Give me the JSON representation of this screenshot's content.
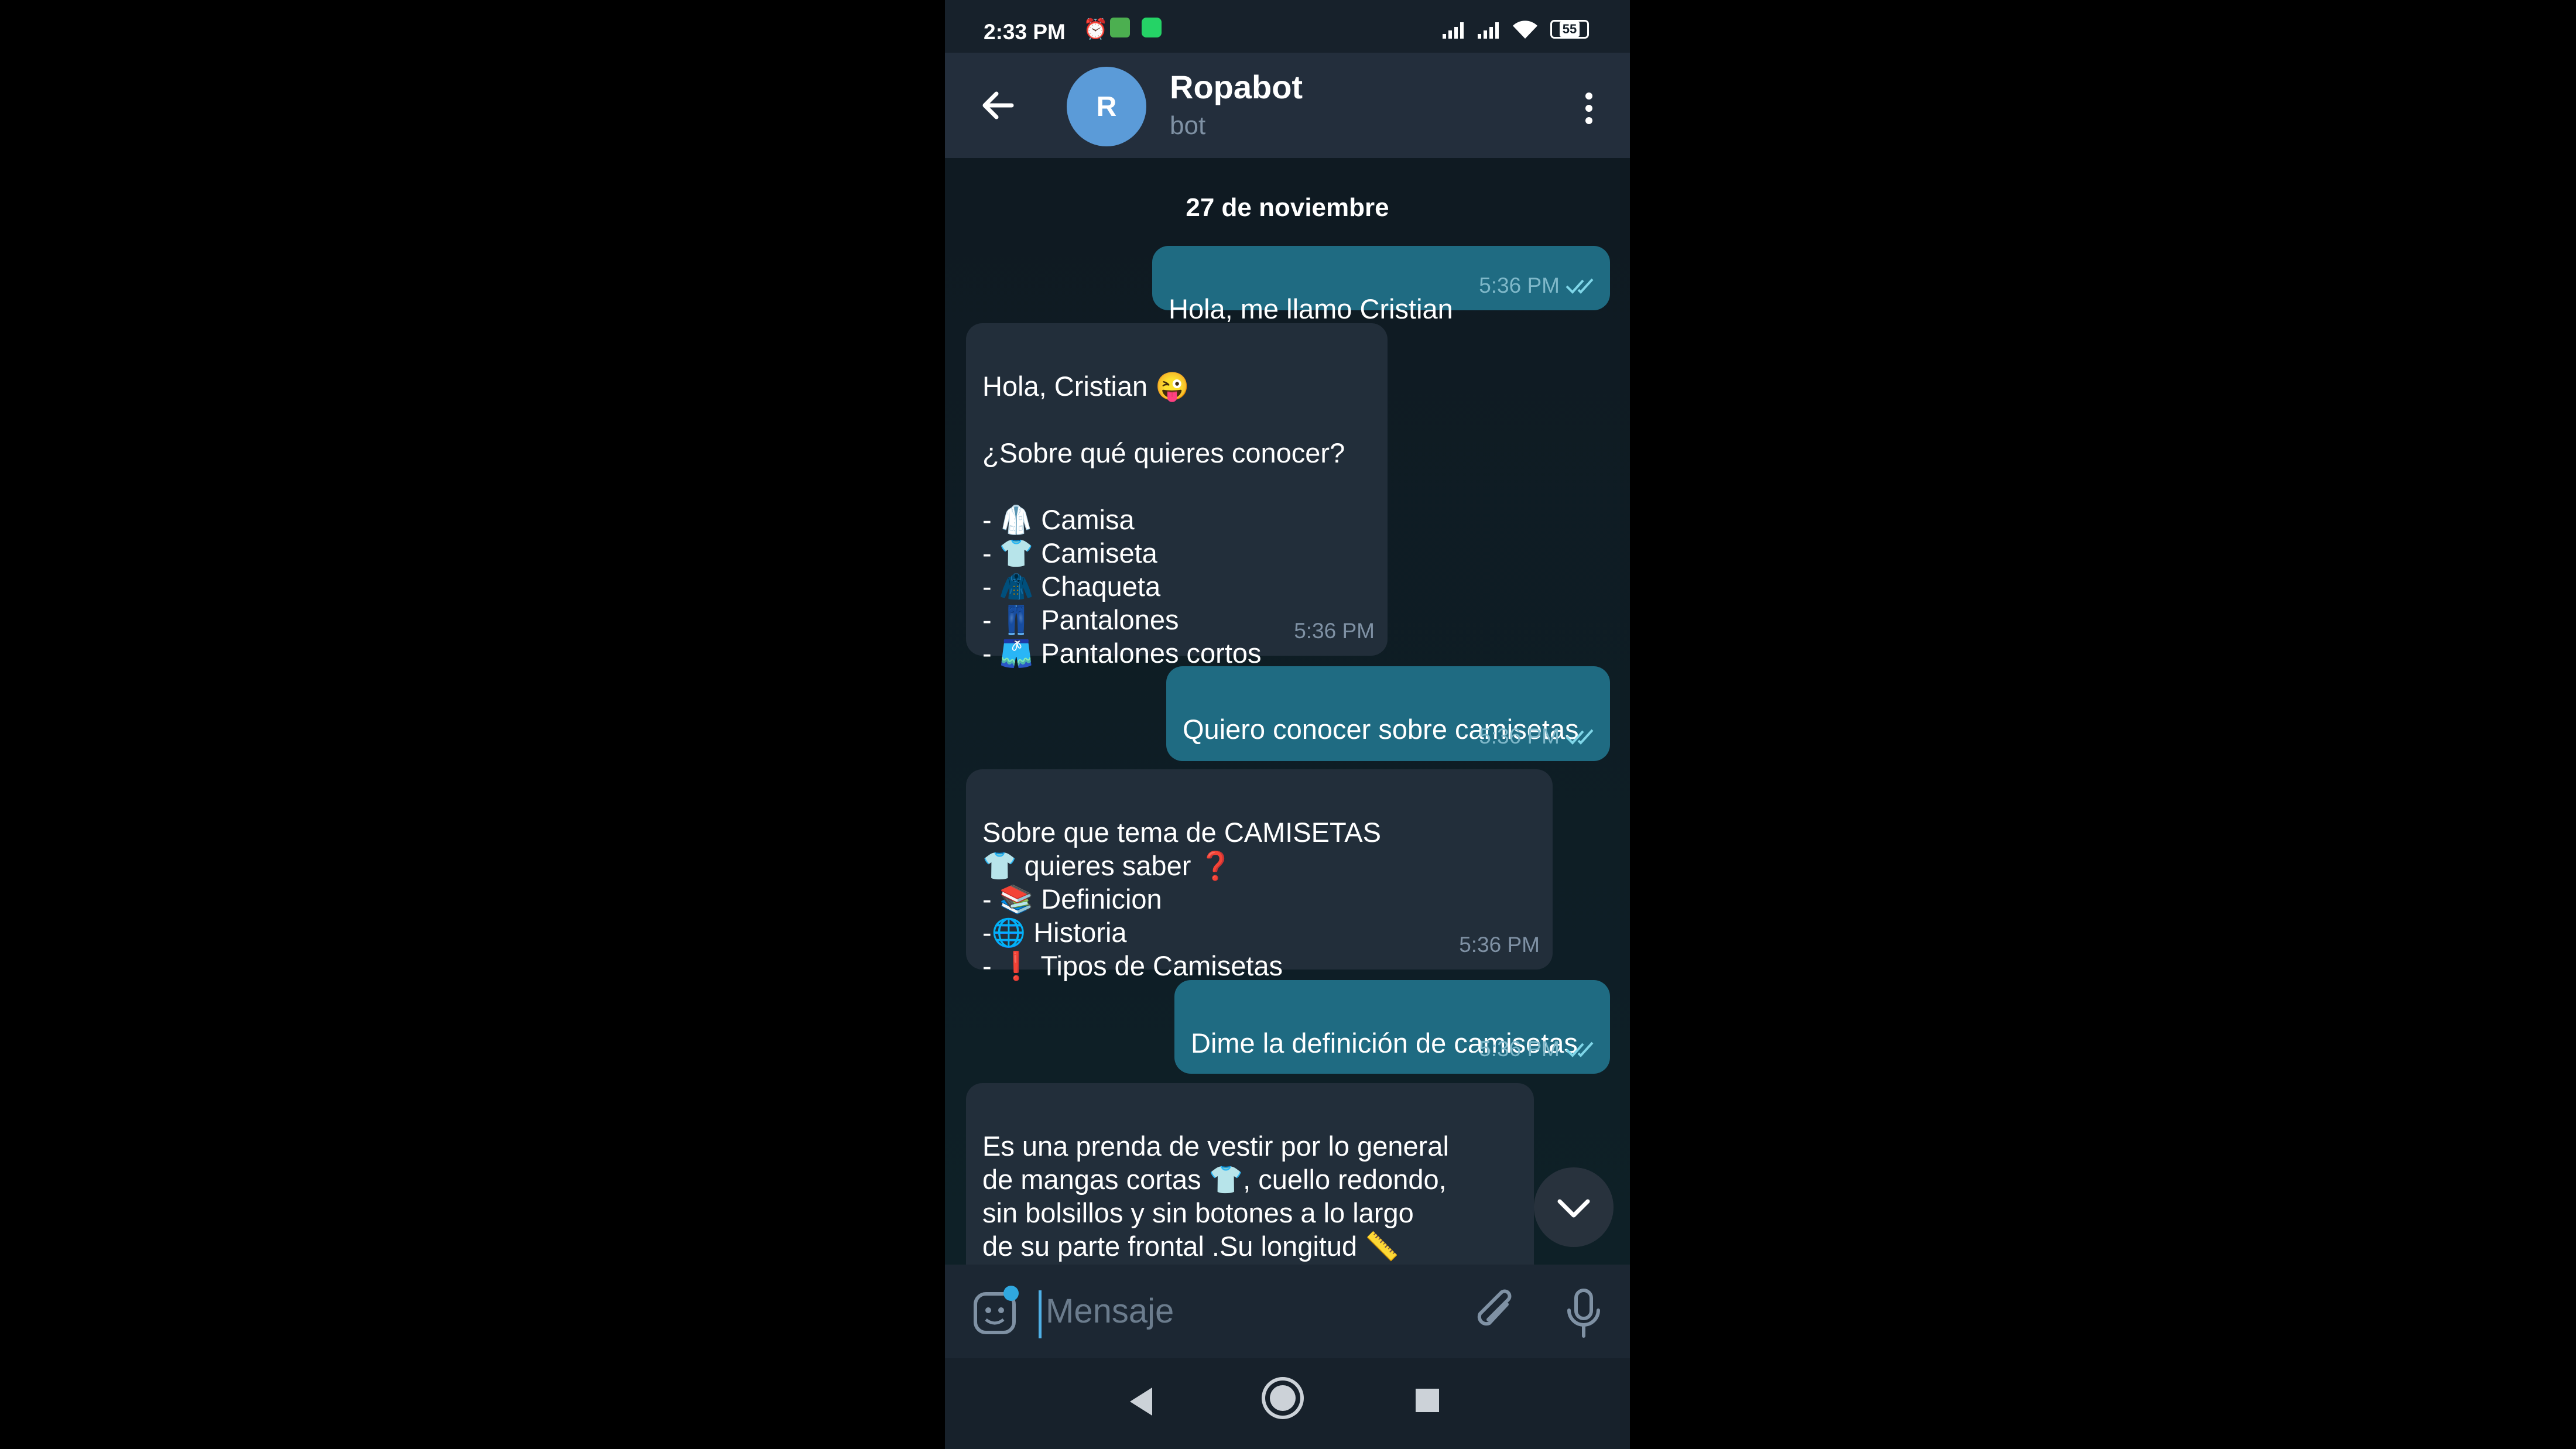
{
  "status_bar": {
    "time": "2:33 PM",
    "battery": "55"
  },
  "header": {
    "avatar_letter": "R",
    "title": "Ropabot",
    "subtitle": "bot"
  },
  "chat": {
    "date_label": "27 de noviembre",
    "messages": [
      {
        "direction": "out",
        "text": "Hola, me llamo Cristian",
        "time": "5:36 PM"
      },
      {
        "direction": "in",
        "text": "Hola, Cristian 😜\n\n¿Sobre qué quieres conocer?\n\n- 🥼 Camisa\n- 👕 Camiseta\n- 🧥 Chaqueta\n- 👖 Pantalones\n- 🩳 Pantalones cortos",
        "time": "5:36 PM"
      },
      {
        "direction": "out",
        "text": "Quiero conocer sobre camisetas",
        "time": "5:36 PM"
      },
      {
        "direction": "in",
        "text": "Sobre que tema de CAMISETAS\n👕 quieres saber ❓\n- 📚 Definicion\n-🌐 Historia\n- ❗ Tipos de Camisetas",
        "time": "5:36 PM"
      },
      {
        "direction": "out",
        "text": "Dime la definición de camisetas",
        "time": "5:36 PM"
      },
      {
        "direction": "in",
        "text": "Es una prenda de vestir por lo general\nde mangas cortas 👕, cuello redondo,\nsin bolsillos y sin botones a lo largo\nde su parte frontal .Su longitud 📏\nvaría desde la mitad del muslo hasta",
        "time": ""
      }
    ]
  },
  "input": {
    "placeholder": "Mensaje"
  },
  "icons": {
    "back": "arrow-left-icon",
    "menu": "kebab-menu-icon",
    "scroll": "chevron-down-icon",
    "sticker": "sticker-icon",
    "attach": "paperclip-icon",
    "voice": "microphone-icon"
  },
  "colors": {
    "accent": "#30a8e0",
    "outgoing_bubble": "#1f6b82",
    "incoming_bubble": "#222e3a"
  }
}
